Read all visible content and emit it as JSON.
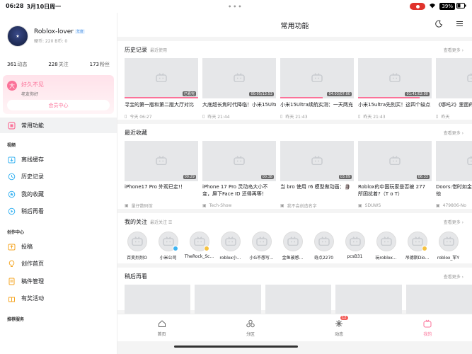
{
  "status": {
    "time": "06:28",
    "date": "3月10日周一",
    "battery": "39%"
  },
  "profile": {
    "name": "Roblox-lover",
    "vip_tag": "年度",
    "sub": "硬币: 220  B币: 0",
    "stats": [
      {
        "num": "361",
        "label": "动态"
      },
      {
        "num": "228",
        "label": "关注"
      },
      {
        "num": "173",
        "label": "粉丝"
      }
    ]
  },
  "promo": {
    "icon_text": "大",
    "title": "好久不见",
    "subtitle": "老友你好",
    "button": "会员中心"
  },
  "sidebar": {
    "active": "常用功能",
    "section_video": "视频",
    "video_items": [
      "离线缓存",
      "历史记录",
      "我的收藏",
      "稍后再看"
    ],
    "section_create": "创作中心",
    "create_items": [
      "投稿",
      "创作首页",
      "稿件管理",
      "有奖活动"
    ],
    "section_rec": "推荐服务"
  },
  "header": {
    "title": "常用功能"
  },
  "history": {
    "title": "历史记录",
    "sub": "最近使用",
    "more": "查看更多 ›",
    "cards": [
      {
        "title": "寻宝的第一版和第二版大厅对比",
        "badge": "已看完",
        "meta": "今天 06:27",
        "progress": 1.0
      },
      {
        "title": "大底超长焦时代降临！小米15Ultra",
        "badge": "00:05/13:53",
        "meta": "昨天 21:44",
        "progress": 0.0
      },
      {
        "title": "小米15Ultra续航实测：一天两充",
        "badge": "04:03/07:00",
        "meta": "昨天 21:43",
        "progress": 0.58
      },
      {
        "title": "小米15ultra先别买！这四个缺点",
        "badge": "01:41/02:00",
        "meta": "昨天 21:43",
        "progress": 0.84
      },
      {
        "title": "《哪吒2》里面的…",
        "badge": "",
        "meta": "昨天",
        "progress": 0.0
      }
    ]
  },
  "favorites": {
    "title": "最近收藏",
    "more": "查看更多 ›",
    "cards": [
      {
        "title": "iPhone17 Pro 外观已定!！",
        "dur": "00:29",
        "author": "量仔数码馆"
      },
      {
        "title": "iPhone 17 Pro 灵动岛大小不变，屏下Face ID 还得再等！",
        "dur": "00:38",
        "author": "Tech-Show"
      },
      {
        "title": "当 bro 使用 r6 模型做动画：🗿",
        "dur": "03:09",
        "author": "我不会创造名字"
      },
      {
        "title": "Roblox的中国玩家是否被 277 所困扰着?（T o T）",
        "dur": "06:33",
        "author": "SDUWS"
      },
      {
        "title": "Doors:惜时如金 Rooms 中的其他",
        "dur": "",
        "author": "479806-No"
      }
    ]
  },
  "follows": {
    "title": "我的关注",
    "sub": "最近关注 ☰",
    "more": "查看更多 ›",
    "users": [
      {
        "name": "百变烈烈O",
        "badge": ""
      },
      {
        "name": "小米公司",
        "badge": "#3db4f2"
      },
      {
        "name": "TheRock_Sc...",
        "badge": "#f5c242"
      },
      {
        "name": "roblox小...",
        "badge": ""
      },
      {
        "name": "小G不想写...",
        "badge": ""
      },
      {
        "name": "金鱼被感...",
        "badge": ""
      },
      {
        "name": "奇点2270",
        "badge": ""
      },
      {
        "name": "pcsB31",
        "badge": ""
      },
      {
        "name": "玩roblox...",
        "badge": ""
      },
      {
        "name": "吊德斯Dio...",
        "badge": "#f5c242"
      },
      {
        "name": "roblox_军Y",
        "badge": ""
      }
    ]
  },
  "watchlater": {
    "title": "稍后再看",
    "more": "查看更多 ›"
  },
  "tabbar": {
    "tabs": [
      "首页",
      "分区",
      "动态",
      "我的"
    ],
    "dynamic_badge": "12"
  },
  "colors": {
    "accent": "#fb7299"
  }
}
